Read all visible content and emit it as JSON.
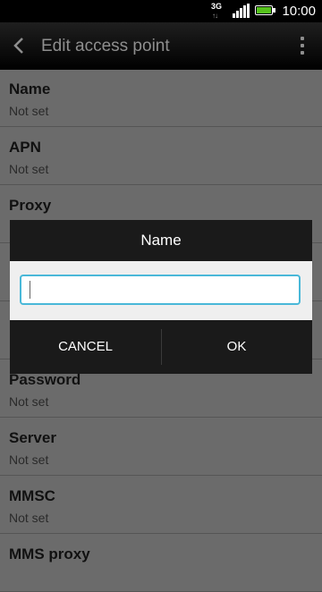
{
  "status_bar": {
    "network_label": "3G",
    "network_arrows": "↑↓",
    "time": "10:00",
    "battery_color": "#55c21b"
  },
  "action_bar": {
    "title": "Edit access point",
    "back_icon": "chevron-left-icon",
    "menu_icon": "overflow-menu-icon"
  },
  "settings": [
    {
      "title": "Name",
      "summary": "Not set"
    },
    {
      "title": "APN",
      "summary": "Not set"
    },
    {
      "title": "Proxy",
      "summary": ""
    },
    {
      "title": "",
      "summary": ""
    },
    {
      "title": "",
      "summary": ""
    },
    {
      "title": "Password",
      "summary": "Not set"
    },
    {
      "title": "Server",
      "summary": "Not set"
    },
    {
      "title": "MMSC",
      "summary": "Not set"
    },
    {
      "title": "MMS proxy",
      "summary": ""
    }
  ],
  "dialog": {
    "title": "Name",
    "input_value": "",
    "cancel_label": "CANCEL",
    "ok_label": "OK",
    "accent_color": "#49b8d8"
  }
}
